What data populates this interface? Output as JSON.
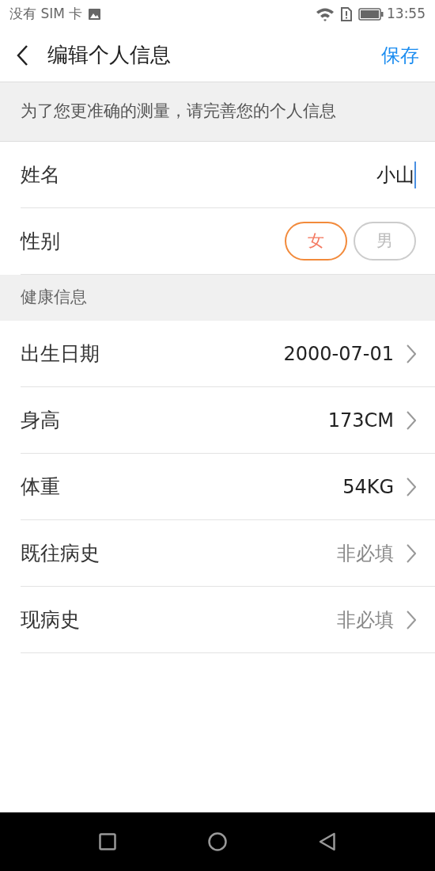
{
  "status_bar": {
    "carrier": "没有 SIM 卡",
    "time": "13:55"
  },
  "header": {
    "title": "编辑个人信息",
    "save": "保存"
  },
  "notice": "为了您更准确的测量，请完善您的个人信息",
  "name": {
    "label": "姓名",
    "value": "小山"
  },
  "gender": {
    "label": "性别",
    "options": [
      {
        "label": "女",
        "selected": true
      },
      {
        "label": "男",
        "selected": false
      }
    ]
  },
  "section_title": "健康信息",
  "rows": [
    {
      "label": "出生日期",
      "value": "2000-07-01"
    },
    {
      "label": "身高",
      "value": "173CM"
    },
    {
      "label": "体重",
      "value": "54KG"
    },
    {
      "label": "既往病史",
      "placeholder": "非必填"
    },
    {
      "label": "现病史",
      "placeholder": "非必填"
    }
  ]
}
